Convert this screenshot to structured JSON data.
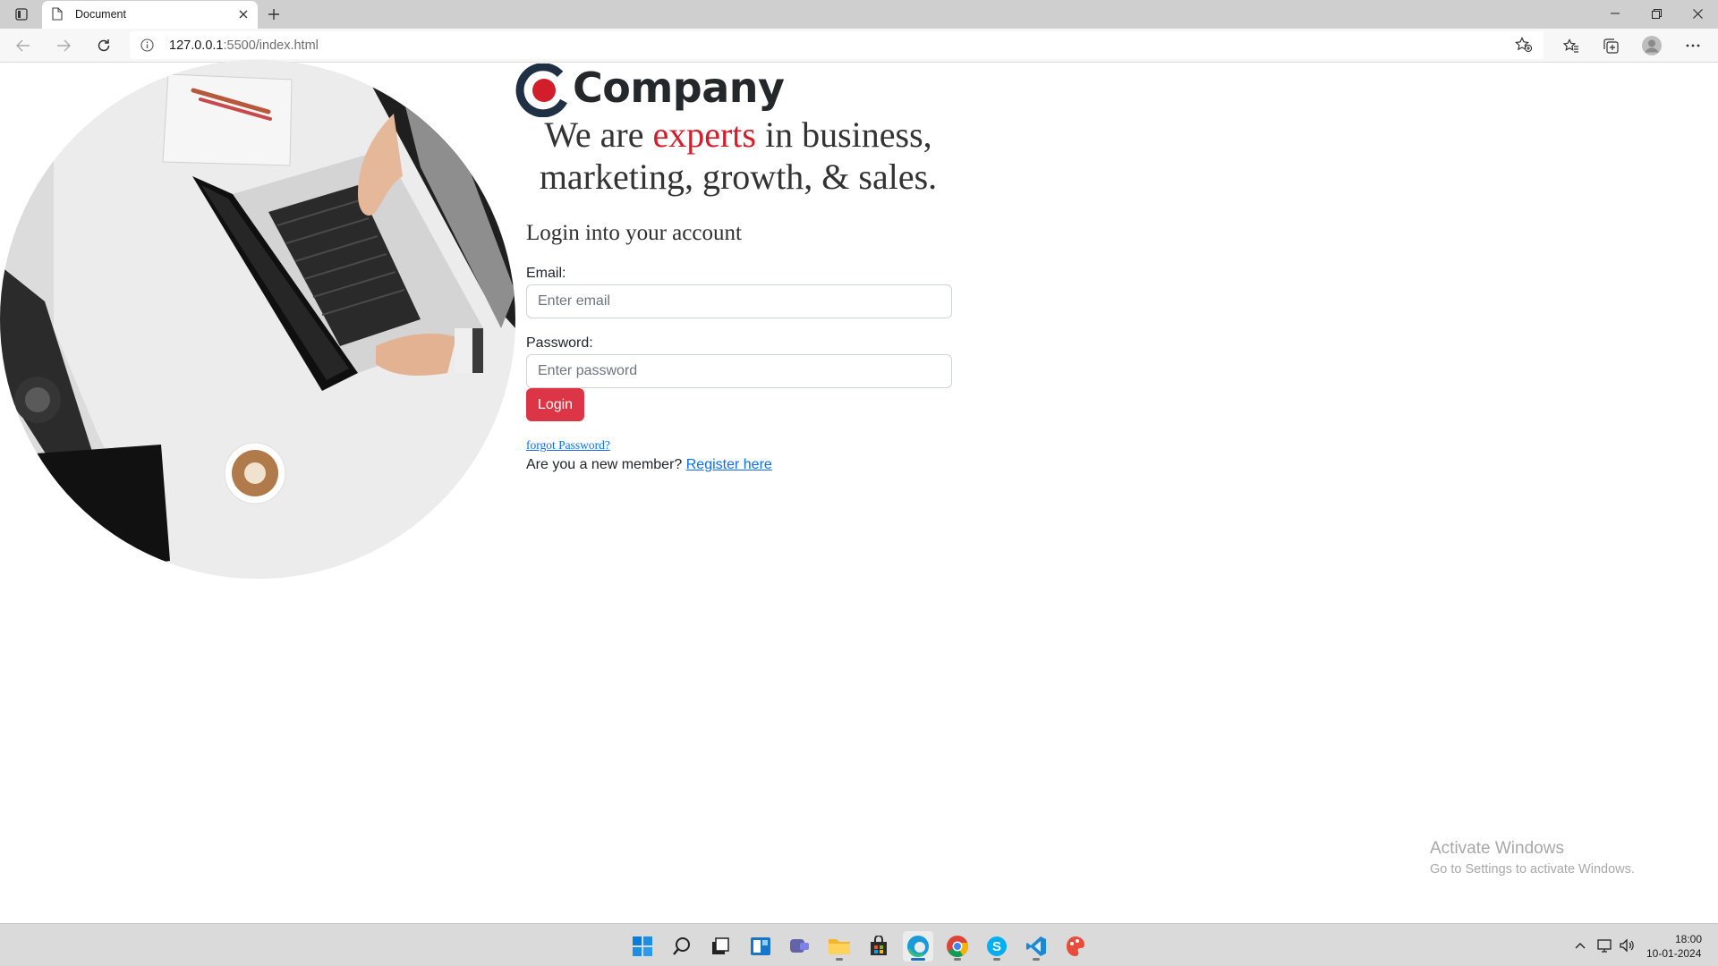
{
  "browser": {
    "tab_title": "Document",
    "url_host": "127.0.0.1",
    "url_path": ":5500/index.html"
  },
  "page": {
    "company_name": "Company",
    "tagline_part1": "We are ",
    "tagline_accent": "experts",
    "tagline_part2": " in business, marketing, growth, & sales.",
    "login_heading": "Login into your account",
    "email_label": "Email:",
    "email_placeholder": "Enter email",
    "password_label": "Password:",
    "password_placeholder": "Enter password",
    "login_button": "Login",
    "forgot_link": "forgot Password?",
    "register_prompt": "Are you a new member? ",
    "register_link": "Register here",
    "colors": {
      "accent": "#d21d2b",
      "button": "#dc3545",
      "link": "#0d6efd",
      "logo_dark": "#1f3044"
    }
  },
  "watermark": {
    "title": "Activate Windows",
    "subtitle": "Go to Settings to activate Windows."
  },
  "taskbar": {
    "apps": [
      "start-icon",
      "search-icon",
      "task-view-icon",
      "widgets-icon",
      "chat-icon",
      "file-explorer-icon",
      "store-icon",
      "edge-icon",
      "chrome-icon",
      "skype-icon",
      "vscode-icon",
      "paint-icon"
    ],
    "time": "18:00",
    "date": "10-01-2024"
  }
}
